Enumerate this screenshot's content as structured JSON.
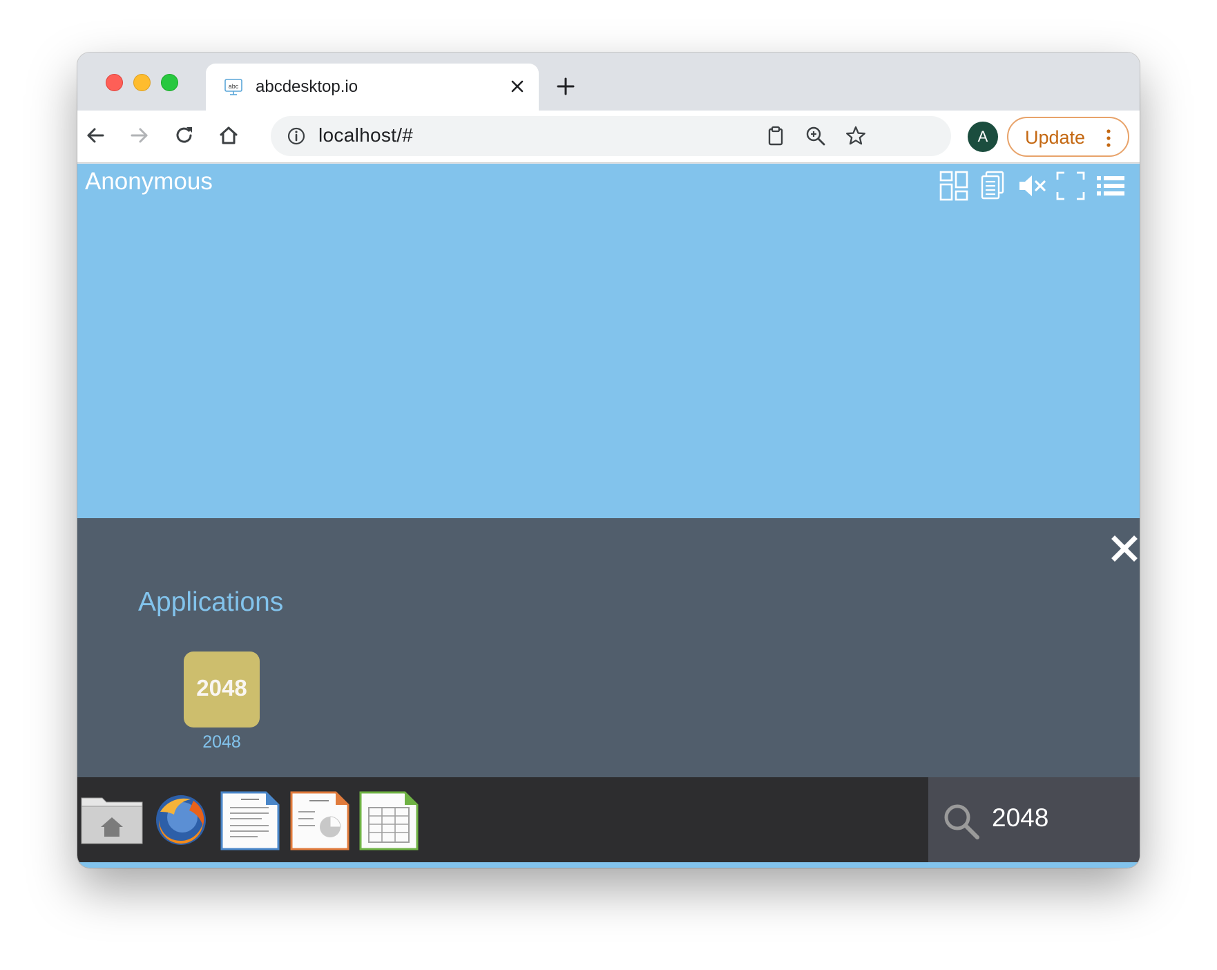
{
  "browser": {
    "tab": {
      "title": "abcdesktop.io",
      "favicon": "abc-icon"
    },
    "address": "localhost/#",
    "profile_initial": "A",
    "update_label": "Update"
  },
  "desktop": {
    "user_name": "Anonymous",
    "toolbar_icons": [
      "grid-layout-icon",
      "documents-icon",
      "mute-icon",
      "fullscreen-icon",
      "list-icon"
    ]
  },
  "applications": {
    "title": "Applications",
    "items": [
      {
        "tile_text": "2048",
        "label": "2048",
        "color": "#cdbe6d"
      }
    ]
  },
  "dock": {
    "items": [
      "home-folder-icon",
      "firefox-icon",
      "writer-icon",
      "impress-icon",
      "calc-icon"
    ],
    "search_value": "2048"
  },
  "colors": {
    "desktop_bg": "#82c3ec",
    "panel_bg": "#515e6c",
    "dock_bg": "#2d2d2f",
    "update_accent": "#c46812"
  }
}
